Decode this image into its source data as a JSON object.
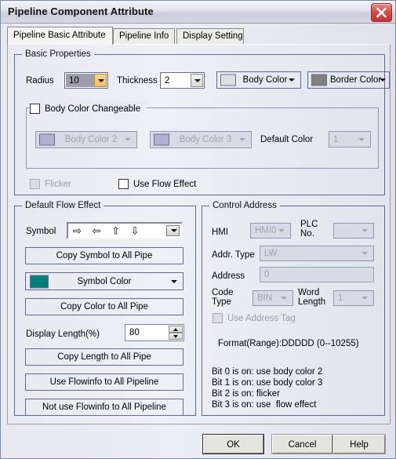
{
  "window": {
    "title": "Pipeline Component Attribute",
    "close_icon": "close-icon"
  },
  "tabs": [
    {
      "label": "Pipeline Basic Attribute",
      "active": true
    },
    {
      "label": "Pipeline Info",
      "active": false
    },
    {
      "label": "Display Setting",
      "active": false
    }
  ],
  "basic_properties": {
    "group_title": "Basic Properties",
    "radius_label": "Radius",
    "radius_value": "10",
    "thickness_label": "Thickness",
    "thickness_value": "2",
    "body_color_label": "Body Color",
    "body_color_hex": "#dedee2",
    "border_color_label": "Border Color",
    "border_color_hex": "#808080",
    "body_color_changeable_label": "Body Color Changeable",
    "body_color_changeable_checked": false,
    "body_color2_label": "Body Color 2",
    "body_color2_hex": "#b0b0d0",
    "body_color3_label": "Body Color 3",
    "body_color3_hex": "#b0b0d0",
    "default_color_label": "Default Color",
    "default_color_value": "1",
    "flicker_label": "Flicker",
    "flicker_checked": false,
    "use_flow_effect_label": "Use Flow Effect",
    "use_flow_effect_checked": false
  },
  "default_flow_effect": {
    "group_title": "Default Flow Effect",
    "symbol_label": "Symbol",
    "symbol_glyphs": "⇨ ⇦ ⇧ ⇩",
    "copy_symbol_button": "Copy Symbol to All Pipe",
    "symbol_color_label": "Symbol Color",
    "symbol_color_hex": "#00807f",
    "copy_color_button": "Copy Color to All Pipe",
    "display_length_label": "Display Length(%)",
    "display_length_value": "80",
    "copy_length_button": "Copy Length to All Pipe",
    "use_flowinfo_button": "Use Flowinfo to All Pipeline",
    "not_use_flowinfo_button": "Not use Flowinfo to All Pipeline"
  },
  "control_address": {
    "group_title": "Control Address",
    "hmi_label": "HMI",
    "hmi_value": "HMI0",
    "plc_no_label": "PLC\nNo.",
    "plc_no_value": "",
    "addr_type_label": "Addr. Type",
    "addr_type_value": "LW",
    "address_label": "Address",
    "address_value": "0",
    "code_type_label": "Code\nType",
    "code_type_value": "BIN",
    "word_length_label": "Word\nLength",
    "word_length_value": "1",
    "use_address_tag_label": "Use Address Tag",
    "use_address_tag_checked": false,
    "format_text": "Format(Range):DDDDD (0--10255)",
    "bit_info_text": "Bit 0 is on: use body color 2\nBit 1 is on: use body color 3\nBit 2 is on: flicker\nBit 3 is on: use  flow effect"
  },
  "footer": {
    "ok_label": "OK",
    "cancel_label": "Cancel",
    "help_label": "Help"
  }
}
